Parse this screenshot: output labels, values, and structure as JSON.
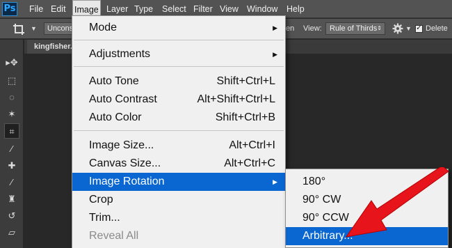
{
  "app": {
    "logo": "Ps"
  },
  "menubar": {
    "items": [
      "File",
      "Edit",
      "Image",
      "Layer",
      "Type",
      "Select",
      "Filter",
      "View",
      "Window",
      "Help"
    ],
    "active": "Image"
  },
  "options": {
    "ratio_value": "Unconstrained",
    "partial_text": "en",
    "view_label": "View:",
    "view_value": "Rule of Thirds",
    "delete_label": "Delete C"
  },
  "document": {
    "tab_title": "kingfisher.jpg"
  },
  "image_menu": {
    "mode": "Mode",
    "adjustments": "Adjustments",
    "auto_tone": {
      "label": "Auto Tone",
      "shortcut": "Shift+Ctrl+L"
    },
    "auto_contrast": {
      "label": "Auto Contrast",
      "shortcut": "Alt+Shift+Ctrl+L"
    },
    "auto_color": {
      "label": "Auto Color",
      "shortcut": "Shift+Ctrl+B"
    },
    "image_size": {
      "label": "Image Size...",
      "shortcut": "Alt+Ctrl+I"
    },
    "canvas_size": {
      "label": "Canvas Size...",
      "shortcut": "Alt+Ctrl+C"
    },
    "image_rotation": "Image Rotation",
    "crop": "Crop",
    "trim": "Trim...",
    "reveal_all": "Reveal All"
  },
  "rotation_submenu": {
    "items": [
      "180°",
      "90° CW",
      "90° CCW",
      "Arbitrary..."
    ],
    "highlighted": "Arbitrary..."
  },
  "colors": {
    "highlight": "#0a67d2",
    "annotation_arrow": "#e8141b",
    "menubar": "#535353",
    "workspace": "#282828"
  },
  "icons": [
    "submenu-arrow-icon",
    "crop-tool-icon",
    "gear-icon",
    "checkbox-icon",
    "move-tool-icon",
    "marquee-tool-icon",
    "lasso-tool-icon",
    "magic-wand-icon",
    "eyedropper-icon",
    "healing-brush-icon",
    "brush-icon",
    "clone-stamp-icon",
    "history-brush-icon",
    "eraser-icon"
  ]
}
